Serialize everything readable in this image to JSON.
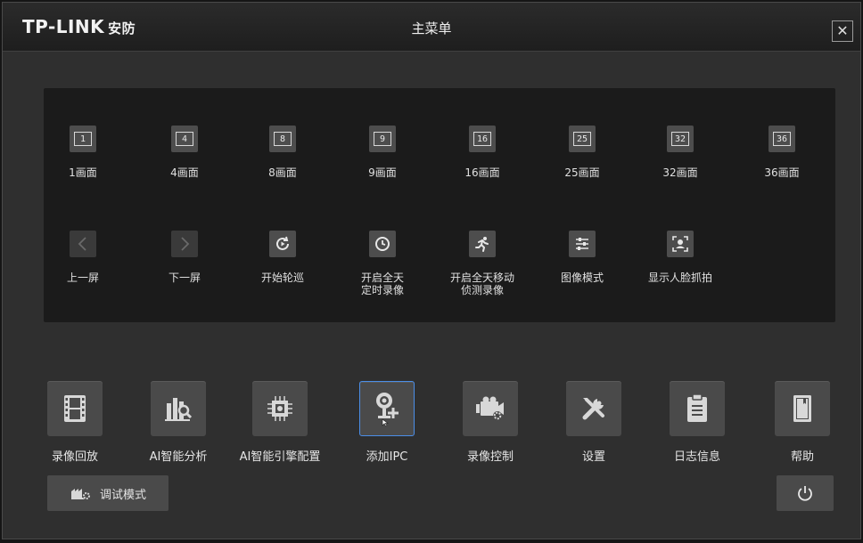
{
  "header": {
    "logo_text": "TP-LINK",
    "logo_sub": "安防",
    "title": "主菜单",
    "close_label": "✕"
  },
  "screens": [
    {
      "icon_text": "1",
      "label": "1画面"
    },
    {
      "icon_text": "4",
      "label": "4画面"
    },
    {
      "icon_text": "8",
      "label": "8画面"
    },
    {
      "icon_text": "9",
      "label": "9画面"
    },
    {
      "icon_text": "16",
      "label": "16画面"
    },
    {
      "icon_text": "25",
      "label": "25画面"
    },
    {
      "icon_text": "32",
      "label": "32画面"
    },
    {
      "icon_text": "36",
      "label": "36画面"
    }
  ],
  "actions": [
    {
      "label": "上一屏",
      "icon": "chevron-left-icon"
    },
    {
      "label": "下一屏",
      "icon": "chevron-right-icon"
    },
    {
      "label": "开始轮巡",
      "icon": "refresh-play-icon"
    },
    {
      "label": "开启全天\n定时录像",
      "icon": "clock-icon"
    },
    {
      "label": "开启全天移动\n侦测录像",
      "icon": "running-man-icon"
    },
    {
      "label": "图像模式",
      "icon": "sliders-icon"
    },
    {
      "label": "显示人脸抓拍",
      "icon": "face-capture-icon"
    }
  ],
  "menu": [
    {
      "label": "录像回放",
      "icon": "film-icon"
    },
    {
      "label": "AI智能分析",
      "icon": "chart-search-icon"
    },
    {
      "label": "AI智能引擎配置",
      "icon": "chip-icon"
    },
    {
      "label": "添加IPC",
      "icon": "camera-add-icon",
      "selected": true
    },
    {
      "label": "录像控制",
      "icon": "video-camera-gear-icon"
    },
    {
      "label": "设置",
      "icon": "tools-icon"
    },
    {
      "label": "日志信息",
      "icon": "clipboard-icon"
    },
    {
      "label": "帮助",
      "icon": "book-icon"
    }
  ],
  "footer": {
    "debug_label": "调试模式"
  },
  "colors": {
    "accent": "#4b8ee8",
    "panel": "#1b1b1b",
    "background": "#2f2f2f"
  }
}
